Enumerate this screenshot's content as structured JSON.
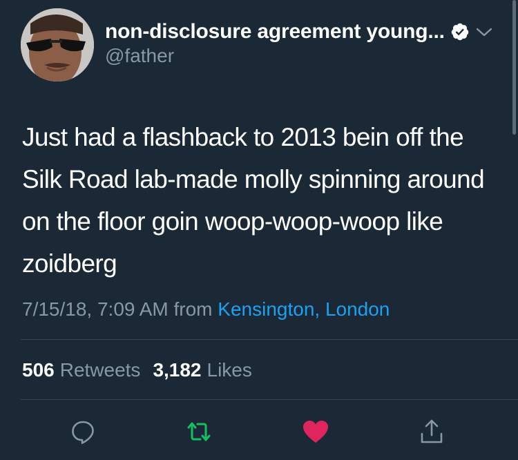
{
  "user": {
    "display_name": "non-disclosure agreement young...",
    "handle": "@father"
  },
  "tweet": {
    "text": "Just had a flashback to 2013 bein off the Silk Road lab-made molly spinning around on the floor goin woop-woop-woop like zoidberg",
    "timestamp": "7/15/18, 7:09 AM",
    "from_label": "from",
    "location": "Kensington, London"
  },
  "stats": {
    "retweets_count": "506",
    "retweets_label": "Retweets",
    "likes_count": "3,182",
    "likes_label": "Likes"
  },
  "icons": {
    "verified": "verified-badge-icon",
    "menu": "chevron-down-icon",
    "reply": "reply-icon",
    "retweet": "retweet-icon",
    "like": "heart-icon",
    "share": "share-icon"
  },
  "colors": {
    "background": "#1b2836",
    "text": "#ffffff",
    "muted": "#8899a6",
    "link": "#1da1f2",
    "retweet": "#17bf63",
    "like": "#e0245e",
    "divider": "#38444d"
  }
}
